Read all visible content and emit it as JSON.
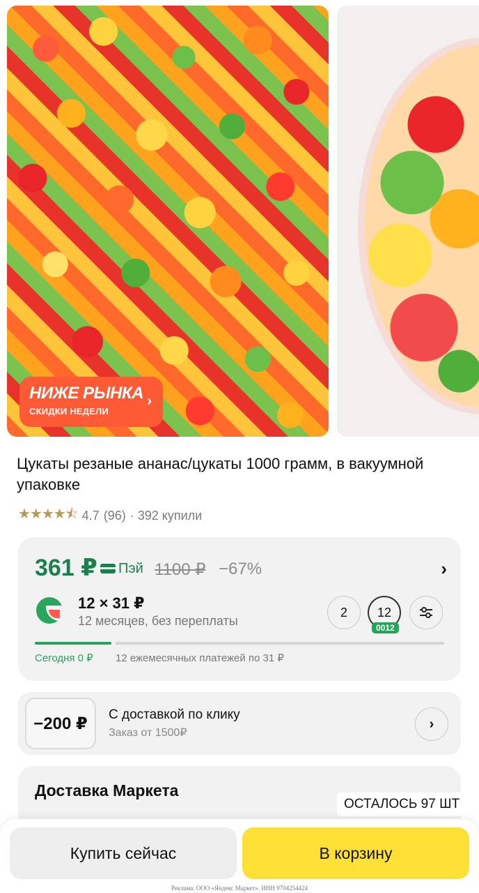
{
  "badge": {
    "title": "НИЖЕ РЫНКА",
    "subtitle": "СКИДКИ НЕДЕЛИ"
  },
  "product": {
    "title": "Цукаты резаные ананас/цукаты 1000 грамм, в вакуумной упаковке",
    "stars": "★★★★⯪",
    "rating": "4.7",
    "reviews": "(96)",
    "bought": "· 392 купили"
  },
  "price": {
    "current": "361 ₽",
    "pay_label": "Пэй",
    "old": "1100 ₽",
    "discount": "−67%",
    "accent_color": "#1d7e4e"
  },
  "split": {
    "amount": "12 × 31 ₽",
    "subtitle": "12 месяцев, без переплаты",
    "terms": [
      "2",
      "12"
    ],
    "selected_tag": "0012",
    "today": "Сегодня 0 ₽",
    "monthly": "12 ежемесячных платежей по 31 ₽"
  },
  "promo": {
    "badge": "−200 ₽",
    "title": "С доставкой по клику",
    "subtitle": "Заказ от 1500₽"
  },
  "delivery": {
    "title": "Доставка Маркета",
    "stock": "ОСТАЛОСЬ 97 ШТ"
  },
  "actions": {
    "buy_now": "Купить сейчас",
    "add_to_cart": "В корзину",
    "cart_color": "#fde036"
  },
  "legal": "Реклама. ООО «Яндекс Маркет». ИНН 9704254424",
  "icons": {
    "chevron": "chevron-right-icon",
    "settings": "sliders-icon",
    "pay": "card-icon",
    "split": "split-logo-icon"
  }
}
